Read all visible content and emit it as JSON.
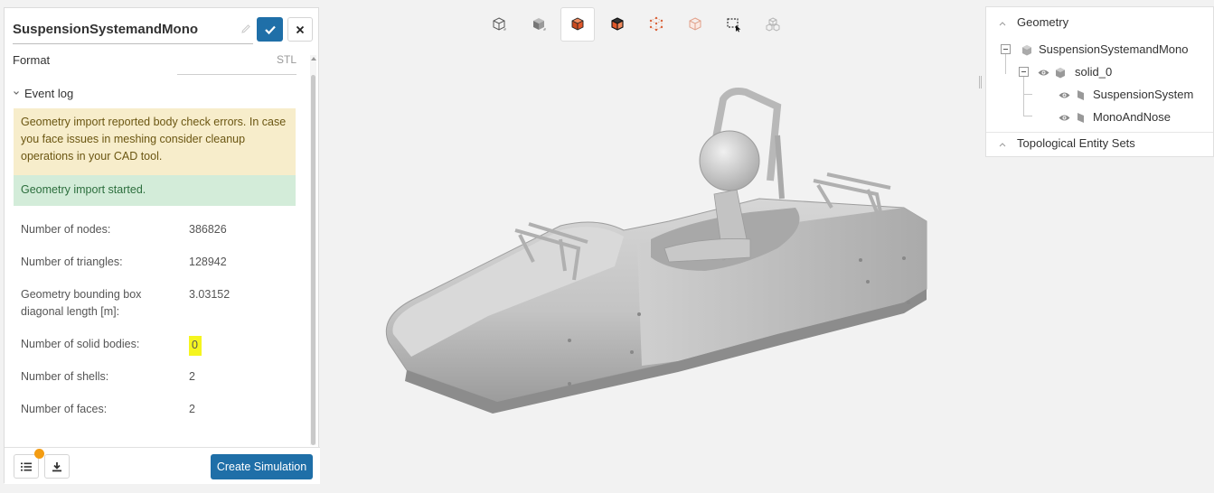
{
  "header": {
    "title": "SuspensionSystemandMono"
  },
  "fields": {
    "format_label": "Format",
    "format_value": "STL"
  },
  "event_log": {
    "title": "Event log",
    "warning": "Geometry import reported body check errors. In case you face issues in meshing consider cleanup operations in your CAD tool.",
    "success": "Geometry import started."
  },
  "stats": [
    {
      "label": "Number of nodes:",
      "value": "386826"
    },
    {
      "label": "Number of triangles:",
      "value": "128942"
    },
    {
      "label": "Geometry bounding box diagonal length [m]:",
      "value": "3.03152"
    },
    {
      "label": "Number of solid bodies:",
      "value": "0"
    },
    {
      "label": "Number of shells:",
      "value": "2"
    },
    {
      "label": "Number of faces:",
      "value": "2"
    }
  ],
  "footer": {
    "create_label": "Create Simulation"
  },
  "tree": {
    "geometry_label": "Geometry",
    "root": "SuspensionSystemandMono",
    "solid": "solid_0",
    "children": [
      "SuspensionSystem",
      "MonoAndNose"
    ],
    "topo_label": "Topological Entity Sets"
  },
  "colors": {
    "primary": "#1f6fa8",
    "warning_bg": "#f7edcb",
    "success_bg": "#d3ecd9",
    "highlight": "#f5f51f",
    "badge": "#f39c12",
    "accent_cube": "#e0572a"
  }
}
